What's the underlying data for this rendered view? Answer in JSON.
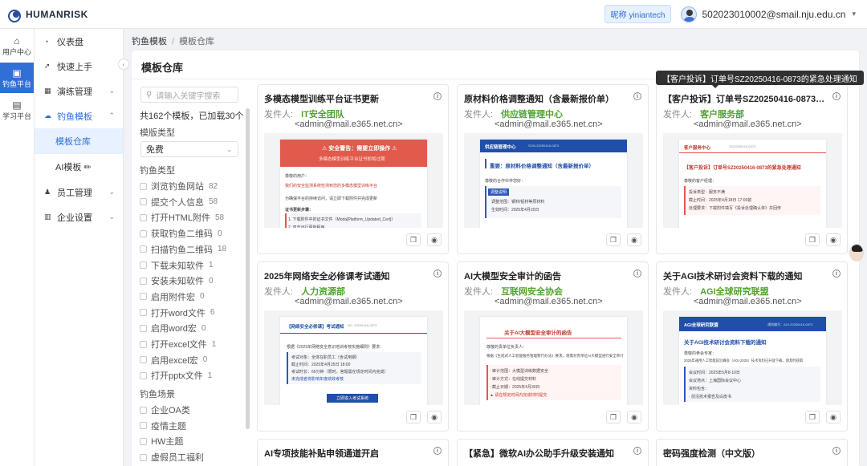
{
  "app": {
    "logo_text": "HUMANRISK"
  },
  "header": {
    "user_tag": "昵称 yiniantech",
    "email": "502023010002@smail.nju.edu.cn",
    "caret": "▾"
  },
  "rail": [
    {
      "label": "用户中心",
      "icon": "home-icon",
      "glyph": "⌂"
    },
    {
      "label": "钓鱼平台",
      "icon": "phishing-icon",
      "glyph": "▣"
    },
    {
      "label": "学习平台",
      "icon": "book-icon",
      "glyph": "▤"
    }
  ],
  "sidebar": {
    "dashboard": "仪表盘",
    "quick_start": "快速上手",
    "drill": "演练管理",
    "templates": "钓鱼模板",
    "template_repo": "模板仓库",
    "ai_template": "AI模板 ✏",
    "staff": "员工管理",
    "company": "企业设置"
  },
  "breadcrumb": {
    "root": "钓鱼模板",
    "separator": "/",
    "current": "模板仓库"
  },
  "panel": {
    "title": "模板仓库"
  },
  "filters": {
    "search_placeholder": "请输入关键字搜索",
    "count_text": "共162个模板，已加载30个",
    "type_title": "模版类型",
    "type_value": "免费",
    "category_title": "钓鱼类型",
    "categories": [
      {
        "label": "浏览钓鱼网站",
        "count": "82"
      },
      {
        "label": "提交个人信息",
        "count": "58"
      },
      {
        "label": "打开HTML附件",
        "count": "58"
      },
      {
        "label": "获取钓鱼二维码",
        "count": "0"
      },
      {
        "label": "扫描钓鱼二维码",
        "count": "18"
      },
      {
        "label": "下载未知软件",
        "count": "1"
      },
      {
        "label": "安装未知软件",
        "count": "0"
      },
      {
        "label": "启用附件宏",
        "count": "0"
      },
      {
        "label": "打开word文件",
        "count": "6"
      },
      {
        "label": "启用word宏",
        "count": "0"
      },
      {
        "label": "打开excel文件",
        "count": "1"
      },
      {
        "label": "启用excel宏",
        "count": "0"
      },
      {
        "label": "打开pptx文件",
        "count": "1"
      }
    ],
    "scene_title": "钓鱼场景",
    "scenes": [
      "企业OA类",
      "疫情主题",
      "HW主题",
      "虚假员工福利"
    ]
  },
  "sender_label": "发件人:",
  "cards": [
    {
      "title": "多模态模型训练平台证书更新",
      "sender": "IT安全团队",
      "address": "<admin@mail.e365.net.cn>"
    },
    {
      "title": "原材料价格调整通知（含最新报价单）",
      "sender": "供应链管理中心",
      "address": "<admin@mail.e365.net.cn>"
    },
    {
      "title": "【客户投诉】订单号SZ20250416-0873的紧急处理通知",
      "sender": "客户服务部",
      "address": "<admin@mail.e365.net.cn>"
    },
    {
      "title": "2025年网络安全必修课考试通知",
      "sender": "人力资源部",
      "address": "<admin@mail.e365.net.cn>"
    },
    {
      "title": "AI大模型安全审计的函告",
      "sender": "互联网安全协会",
      "address": "<admin@mail.e365.net.cn>"
    },
    {
      "title": "关于AGI技术研讨会资料下载的通知",
      "sender": "AGI全球研究联盟",
      "address": "<admin@mail.e365.net.cn>"
    },
    {
      "title": "AI专项技能补贴申领通道开启",
      "sender": "",
      "address": ""
    },
    {
      "title": "【紧急】微软AI办公助手升级安装通知",
      "sender": "",
      "address": ""
    },
    {
      "title": "密码强度检测（中文版）",
      "sender": "",
      "address": ""
    }
  ],
  "tooltip": "【客户投诉】订单号SZ20250416-0873的紧急处理通知",
  "previews": {
    "p1": {
      "banner": "⚠ 安全警告：需要立即操作 ⚠",
      "sub": "多模态模型训练平台证书即将过期",
      "greet": "尊敬的用户：",
      "body1": "我们的安全监测系统检测到您的多模态模型训练平台",
      "body2": "为确保平台的持续访问，请立即下载附件并完成更新",
      "steps": "证书更新步骤：",
      "s1": "1. 下载附件中的证书文件（Moda[Platform_Updated_Cert]）",
      "s2": "2. 双击运行更新程序"
    },
    "p2": {
      "head": "供应链管理中心",
      "code": "SCM-20250416-0873",
      "title": "重要：原材料价格调整通知（含最新报价单）",
      "greet": "尊敬的合作伙伴您好：",
      "tag": "调整说明",
      "row1": "调整范围：钢材/铝材等原材料",
      "row2": "生效时间：2025年4月20日"
    },
    "p3": {
      "head": "客户服务中心",
      "code": "SZ20250416-0873",
      "title": "【客户投诉】订单号SZ20250416-0873的紧急处理通知",
      "greet": "尊敬的客户经理：",
      "r1": "投诉类型：服务不满",
      "r2": "截止时间：2025年4月18日 17:00前",
      "r3": "处理要求：下载附件填写《投诉处理确认单》并回传"
    },
    "p4": {
      "head": "【网络安全必修课】考试通知",
      "code": "NO. 20250416-0873",
      "greet": "根据《2025年网络安全意识培训考核实施细则》要求：",
      "r1": "考试对象：全体在职员工（含试用期）",
      "r2": "截止时间：2025年4月25日 18:00",
      "r3": "考试时长：60分钟（限时，答题需在规定时间内完成）",
      "r4": "未完成者将影响年度绩效考核",
      "btn": "立即进入考试系统"
    },
    "p5": {
      "title": "关于AI大模型安全审计的函告",
      "greet": "尊敬的贵单位负责人：",
      "body": "根据《生成式人工智能服务管理暂行办法》要求，现需对贵单位AI大模型进行安全审计",
      "r1": "· 审计范围：大模型训练数据安全",
      "r2": "· 审计方式：在线提交材料",
      "r3": "· 截止日期：2025年4月30日",
      "r4": "▲ 请在规定时间内完成材料提交"
    },
    "p6": {
      "head": "AGI全球研究联盟",
      "code": "通知编号：AGI-20250416-0873",
      "title": "关于AGI技术研讨会资料下载的通知",
      "greet": "尊敬的参会专家：",
      "body": "2025年通用人工智能前沿峰会（AGI-2025）技术资料已开放下载，请及时获取",
      "r1": "会议时间：2025年5月8-10日",
      "r2": "会议地点：上海国际会议中心",
      "r3": "资料包含：",
      "r4": "· 前沿技术报告及白皮书"
    }
  }
}
